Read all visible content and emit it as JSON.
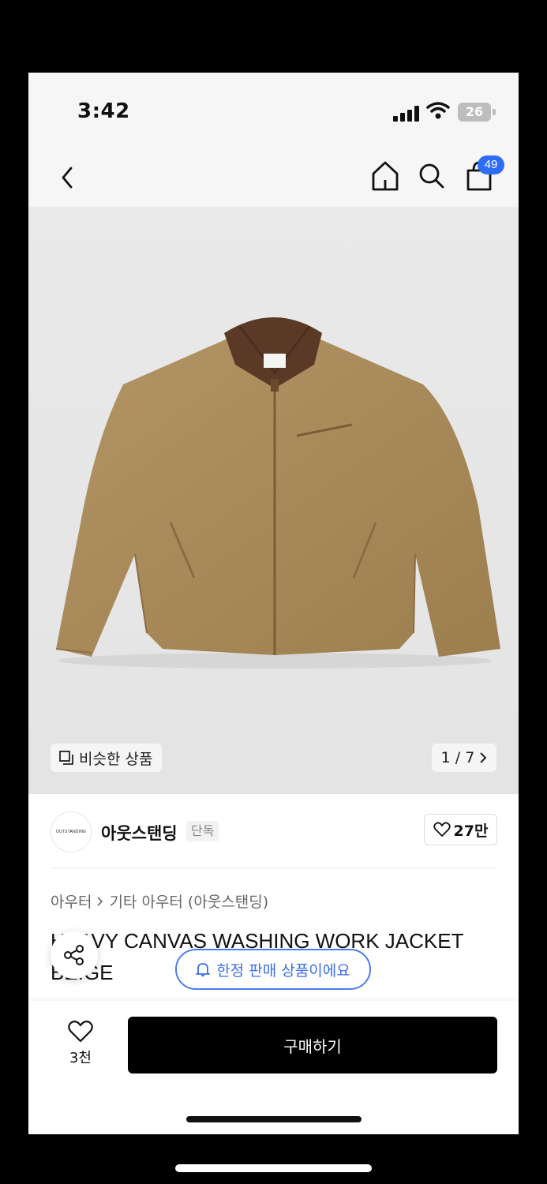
{
  "status_bar": {
    "time": "3:42",
    "battery": "26"
  },
  "nav": {
    "cart_count": "49"
  },
  "image": {
    "similar_label": "비슷한 상품",
    "counter": "1 / 7"
  },
  "brand": {
    "logo_text": "OUTSTANDING",
    "name": "아웃스탠딩",
    "tag": "단독",
    "likes": "27만"
  },
  "breadcrumb": {
    "level1": "아우터",
    "level2": "기타 아우터 (아웃스탠딩)"
  },
  "product": {
    "title": "HEAVY CANVAS WASHING WORK JACKET BEIGE",
    "limited_label": "한정 판매 상품이에요"
  },
  "bottom_bar": {
    "like_count": "3천",
    "buy_label": "구매하기"
  },
  "colors": {
    "accent": "#2d6df6",
    "jacket": "#a98a58",
    "collar": "#5a3a26",
    "buy_button": "#000000"
  }
}
